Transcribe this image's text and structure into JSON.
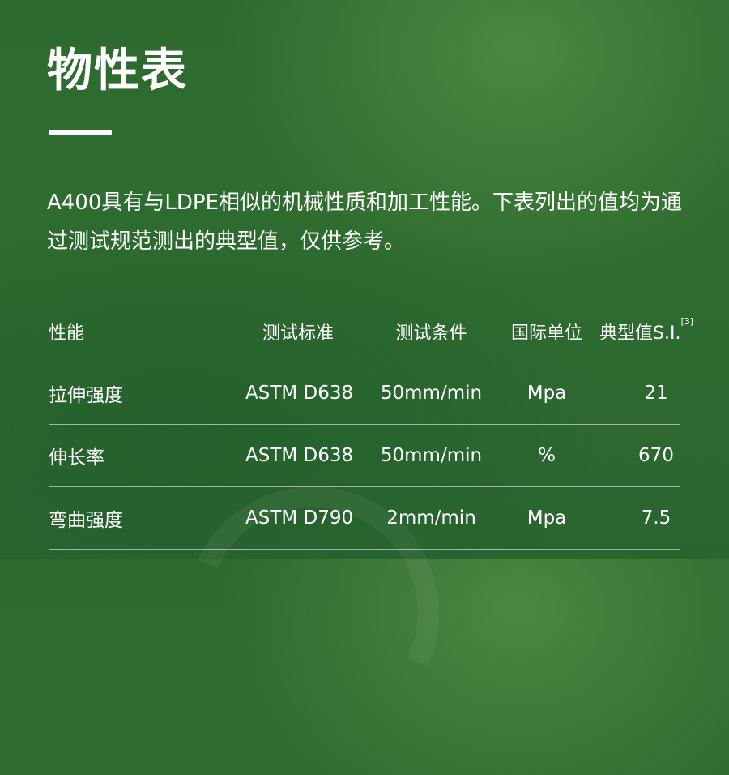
{
  "page": {
    "title": "物性表",
    "intro": "A400具有与LDPE相似的机械性质和加工性能。下表列出的值均为通过测试规范测出的典型值，仅供参考。"
  },
  "table": {
    "headers": {
      "property": "性能",
      "standard": "测试标准",
      "condition": "测试条件",
      "unit": "国际单位",
      "typical": "典型值S.I.",
      "typical_note": "[3]"
    },
    "rows": [
      {
        "property": "拉伸强度",
        "standard": "ASTM D638",
        "condition": "50mm/min",
        "unit": "Mpa",
        "value": "21"
      },
      {
        "property": "伸长率",
        "standard": "ASTM D638",
        "condition": "50mm/min",
        "unit": "%",
        "value": "670"
      },
      {
        "property": "弯曲强度",
        "standard": "ASTM D790",
        "condition": "2mm/min",
        "unit": "Mpa",
        "value": "7.5"
      }
    ]
  },
  "colors": {
    "background": "#2f6d30",
    "text": "#ffffff"
  }
}
